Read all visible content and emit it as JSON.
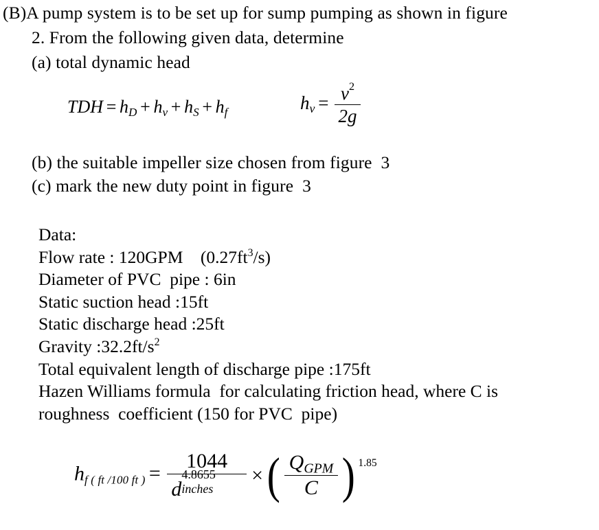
{
  "document": {
    "type": "homework-problem",
    "background_color": "#ffffff",
    "text_color": "#000000"
  },
  "prompt": {
    "label": "(B)",
    "line1": "(B)A pump system is to be set up for sump pumping as shown in figure",
    "line2": "2. From the following given data, determine",
    "part_a": "(a) total dynamic head",
    "part_b": "(b) the suitable impeller size chosen from figure  3",
    "part_c": "(c) mark the new duty point in figure  3"
  },
  "equation_tdh": {
    "lhs": "TDH",
    "equals": "=",
    "terms": [
      {
        "base": "h",
        "sub": "D"
      },
      {
        "base": "h",
        "sub": "v"
      },
      {
        "base": "h",
        "sub": "S"
      },
      {
        "base": "h",
        "sub": "f"
      }
    ],
    "plus": "+",
    "rendered": "TDH = hD + hv + hS + hf"
  },
  "equation_hv": {
    "lhs_base": "h",
    "lhs_sub": "v",
    "equals": "=",
    "numerator_base": "v",
    "numerator_exp": "2",
    "denominator": "2g",
    "rendered": "hv = v^2 / 2g"
  },
  "data": {
    "heading": "Data:",
    "items": [
      {
        "label": "Flow rate :",
        "value": "120GPM",
        "alt_value_prefix": "(0.27ft",
        "alt_value_exp": "3",
        "alt_value_suffix": "/s)",
        "line": "Flow rate : 120GPM    (0.27ft3/s)"
      },
      {
        "label": "Diameter of PVC  pipe :",
        "value": "6in",
        "line": "Diameter of PVC  pipe : 6in"
      },
      {
        "label": "Static suction head :",
        "value": "15ft",
        "line": "Static suction head :15ft"
      },
      {
        "label": "Static discharge head :",
        "value": "25ft",
        "line": "Static discharge head :25ft"
      },
      {
        "label": "Gravity :",
        "value": "32.2ft/s",
        "exp": "2",
        "line": "Gravity :32.2ft/s2"
      },
      {
        "label": "Total equivalent length of discharge pipe :",
        "value": "175ft",
        "line": "Total equivalent length of discharge pipe :175ft"
      }
    ],
    "note_line1": "Hazen Williams formula  for calculating friction head, where C is",
    "note_line2": "roughness  coefficient (150 for PVC  pipe)"
  },
  "equation_hazen": {
    "lhs_base": "h",
    "lhs_sub": "f ( ft /100 ft )",
    "equals": "=",
    "numerator": "1044",
    "denominator_base": "d",
    "denominator_exp": "4.8655",
    "denominator_sub": "inches",
    "times": "×",
    "paren_open": "(",
    "paren_close": ")",
    "inner_numerator_base": "Q",
    "inner_numerator_sub": "GPM",
    "inner_denominator": "C",
    "outer_exponent": "1.85",
    "rendered": "hf(ft/100ft) = 1044 / d_inches^4.8655 x (Q_GPM / C)^1.85"
  }
}
